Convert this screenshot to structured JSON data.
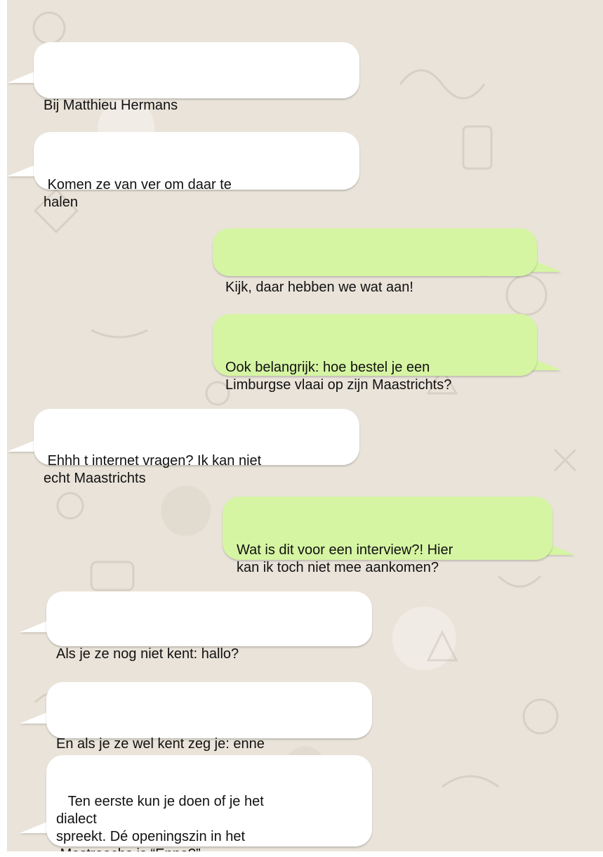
{
  "messages": [
    {
      "direction": "incoming",
      "text": "Bij Matthieu Hermans"
    },
    {
      "direction": "incoming",
      "text": " Komen ze van ver om daar te\nhalen"
    },
    {
      "direction": "outgoing",
      "text": "Kijk, daar hebben we wat aan!"
    },
    {
      "direction": "outgoing",
      "text": "Ook belangrijk: hoe bestel je een\nLimburgse vlaai op zijn Maastrichts?"
    },
    {
      "direction": "incoming",
      "text": " Ehhh t internet vragen? Ik kan niet\necht Maastrichts"
    },
    {
      "direction": "outgoing",
      "text": "Wat is dit voor een interview?! Hier\nkan ik toch niet mee aankomen?"
    },
    {
      "direction": "incoming",
      "text": "Als je ze nog niet kent: hallo?"
    },
    {
      "direction": "incoming",
      "text": "En als je ze wel kent zeg je: enne"
    },
    {
      "direction": "incoming",
      "text": "   Ten eerste kun je doen of je het\ndialect\nspreekt. Dé openingszin in het\n Mestreechs is “Enne?”"
    }
  ],
  "colors": {
    "incoming_bubble": "#ffffff",
    "outgoing_bubble": "#d6f5a3",
    "wallpaper": "#e9e3d9"
  }
}
